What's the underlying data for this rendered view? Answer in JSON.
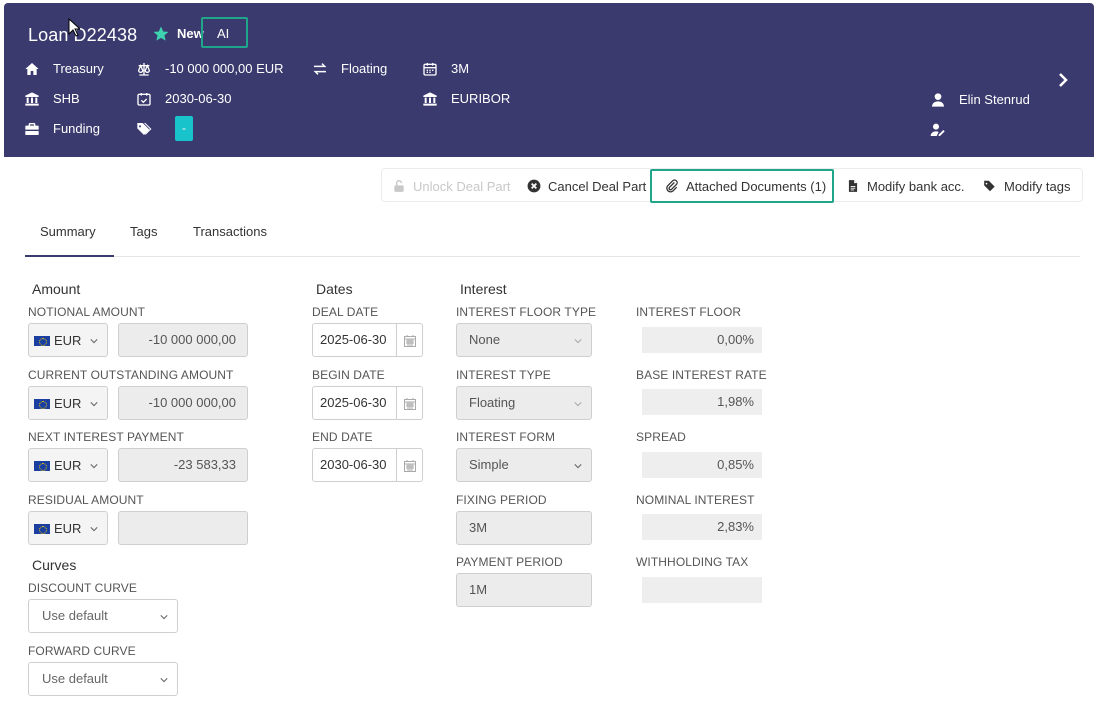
{
  "header": {
    "title": "Loan D22438",
    "status": "New",
    "ai_label": "AI",
    "treasury": "Treasury",
    "amount": "-10 000 000,00 EUR",
    "interest_type": "Floating",
    "period": "3M",
    "bank": "SHB",
    "maturity": "2030-06-30",
    "index": "EURIBOR",
    "category": "Funding",
    "tag": "-",
    "user": "Elin Stenrud"
  },
  "toolbar": {
    "unlock": "Unlock Deal Part",
    "cancel": "Cancel Deal Part",
    "attached": "Attached Documents (1)",
    "modify_bank": "Modify bank acc.",
    "modify_tags": "Modify tags"
  },
  "tabs": [
    "Summary",
    "Tags",
    "Transactions"
  ],
  "amount": {
    "title": "Amount",
    "notional_label": "NOTIONAL AMOUNT",
    "notional_ccy": "EUR",
    "notional_value": "-10 000 000,00",
    "outstanding_label": "CURRENT OUTSTANDING AMOUNT",
    "outstanding_ccy": "EUR",
    "outstanding_value": "-10 000 000,00",
    "next_label": "NEXT INTEREST PAYMENT",
    "next_ccy": "EUR",
    "next_value": "-23 583,33",
    "residual_label": "RESIDUAL AMOUNT",
    "residual_ccy": "EUR",
    "residual_value": ""
  },
  "curves": {
    "title": "Curves",
    "discount_label": "DISCOUNT CURVE",
    "discount_value": "Use default",
    "forward_label": "FORWARD CURVE",
    "forward_value": "Use default"
  },
  "dates": {
    "title": "Dates",
    "deal_label": "DEAL DATE",
    "deal_value": "2025-06-30",
    "begin_label": "BEGIN DATE",
    "begin_value": "2025-06-30",
    "end_label": "END DATE",
    "end_value": "2030-06-30"
  },
  "interest": {
    "title": "Interest",
    "floor_type_label": "INTEREST FLOOR TYPE",
    "floor_type_value": "None",
    "type_label": "INTEREST TYPE",
    "type_value": "Floating",
    "form_label": "INTEREST FORM",
    "form_value": "Simple",
    "fixing_label": "FIXING PERIOD",
    "fixing_value": "3M",
    "payment_label": "PAYMENT PERIOD",
    "payment_value": "1M",
    "floor_label": "INTEREST FLOOR",
    "floor_value": "0,00%",
    "base_label": "BASE INTEREST RATE",
    "base_value": "1,98%",
    "spread_label": "SPREAD",
    "spread_value": "0,85%",
    "nominal_label": "NOMINAL INTEREST",
    "nominal_value": "2,83%",
    "withholding_label": "WITHHOLDING TAX",
    "withholding_value": ""
  },
  "colors": {
    "header_bg": "#3a3a6e",
    "accent_teal": "#1fa58a",
    "tag_chip": "#18c3cc",
    "star": "#3dd3b0"
  }
}
